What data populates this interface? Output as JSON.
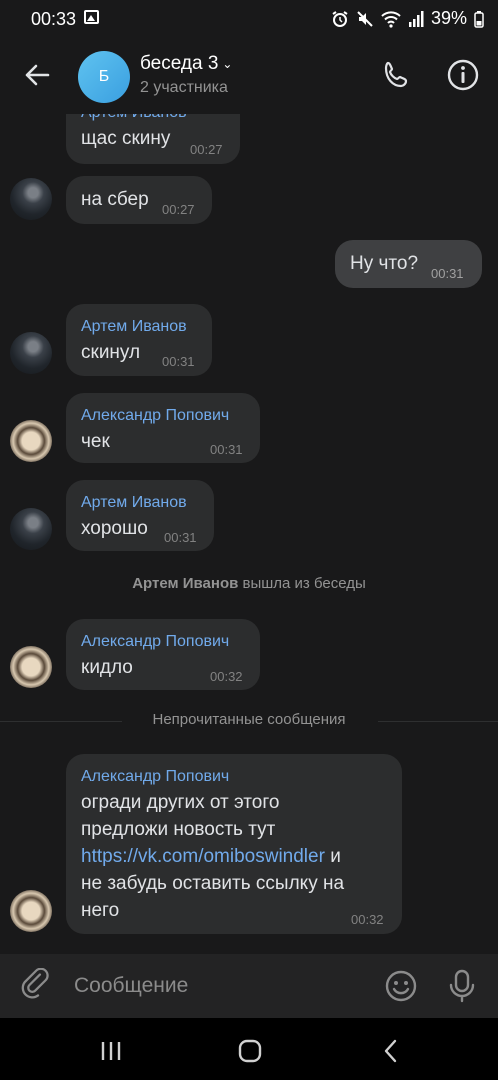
{
  "status_bar": {
    "time": "00:33",
    "icons": [
      "gallery-icon",
      "alarm-icon",
      "mute-icon",
      "wifi-icon",
      "signal-icon"
    ],
    "battery": "39%"
  },
  "header": {
    "avatar_letter": "Б",
    "title": "беседа 3",
    "subtitle": "2 участника"
  },
  "messages": [
    {
      "author": "Артем Иванов",
      "text": "щас скину",
      "time": "00:27"
    },
    {
      "text": "на сбер",
      "time": "00:27"
    },
    {
      "text": "Ну что?",
      "time": "00:31",
      "outgoing": true
    },
    {
      "author": "Артем Иванов",
      "text": "скинул",
      "time": "00:31"
    },
    {
      "author": "Александр Попович",
      "text": "чек",
      "time": "00:31"
    },
    {
      "author": "Артем Иванов",
      "text": "хорошо",
      "time": "00:31"
    },
    {
      "author": "Александр Попович",
      "text": "кидло",
      "time": "00:32"
    },
    {
      "author": "Александр Попович",
      "lines": [
        "огради других от этого",
        "предложи новость тут"
      ],
      "link": "https://vk.com/omiboswindler",
      "after_link": " и",
      "last_lines": [
        "не забудь оставить ссылку на",
        "него"
      ],
      "time": "00:32"
    }
  ],
  "system_event": {
    "name": "Артем Иванов",
    "action": " вышла из беседы"
  },
  "unread_divider": "Непрочитанные сообщения",
  "composer": {
    "placeholder": "Сообщение"
  },
  "colors": {
    "background": "#19191a",
    "bubble": "#2c2d2e",
    "author": "#71aaeb",
    "link": "#71aaeb"
  }
}
